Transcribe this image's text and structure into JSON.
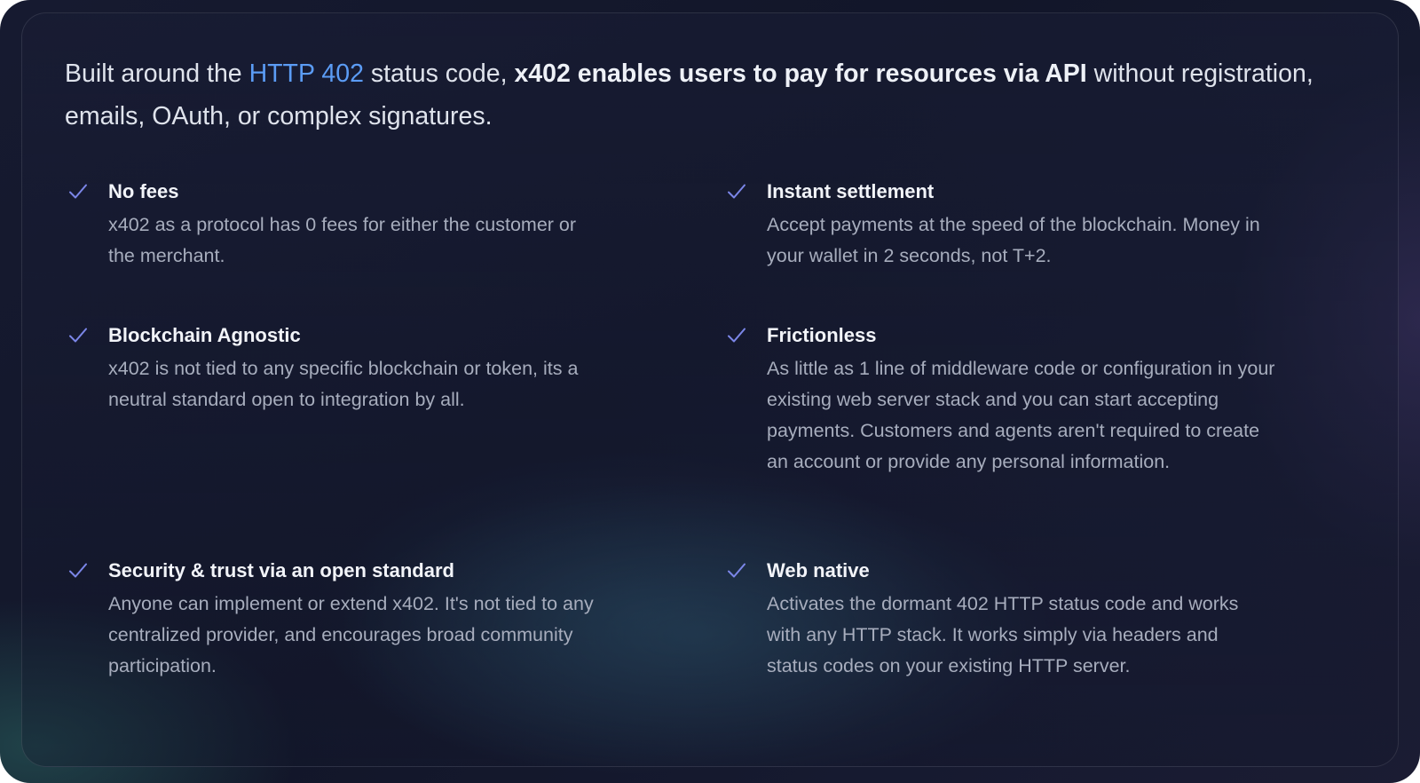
{
  "intro": {
    "prefix": "Built around the ",
    "link": "HTTP 402",
    "middle": " status code, ",
    "bold": "x402 enables users to pay for resources via API",
    "suffix": " without registration, emails, OAuth, or complex signatures."
  },
  "features": [
    {
      "icon": "check-icon",
      "title": "No fees",
      "description": "x402 as a protocol has 0 fees for either the customer or the merchant."
    },
    {
      "icon": "check-icon",
      "title": "Instant settlement",
      "description": "Accept payments at the speed of the blockchain. Money in your wallet in 2 seconds, not T+2."
    },
    {
      "icon": "check-icon",
      "title": "Blockchain Agnostic",
      "description": "x402 is not tied to any specific blockchain or token, its a neutral standard open to integration by all."
    },
    {
      "icon": "check-icon",
      "title": "Frictionless",
      "description": "As little as 1 line of middleware code or configuration in your existing web server stack and you can start accepting payments. Customers and agents aren't required to create an account or provide any personal information."
    },
    {
      "icon": "check-icon",
      "title": "Security & trust via an open standard",
      "description": "Anyone can implement or extend x402. It's not tied to any centralized provider, and encourages broad community participation."
    },
    {
      "icon": "check-icon",
      "title": "Web native",
      "description": "Activates the dormant 402 HTTP status code and works with any HTTP stack. It works simply via headers and status codes on your existing HTTP server."
    }
  ],
  "colors": {
    "accent_link": "#5b9cf5",
    "check": "#7b86e8",
    "background": "#141830"
  }
}
